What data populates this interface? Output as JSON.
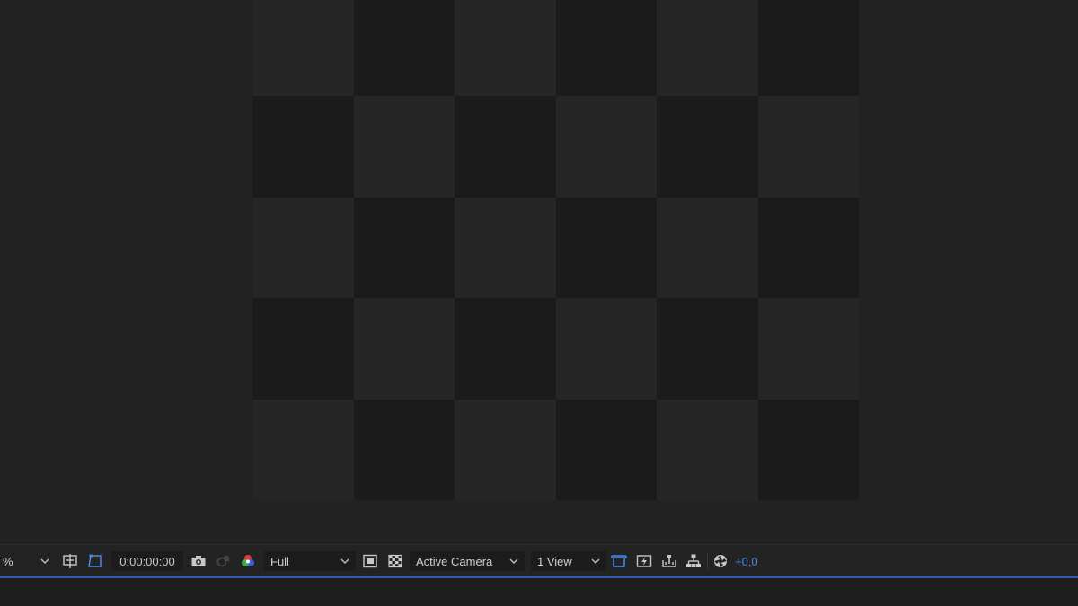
{
  "viewer": {
    "checker_pattern": [
      [
        0,
        1,
        0,
        1,
        0,
        1
      ],
      [
        1,
        0,
        1,
        0,
        1,
        0
      ],
      [
        0,
        1,
        0,
        1,
        0,
        1
      ],
      [
        1,
        0,
        1,
        0,
        1,
        0
      ],
      [
        0,
        1,
        0,
        1,
        0,
        1
      ]
    ]
  },
  "toolbar": {
    "magnification": "%",
    "timecode": "0:00:00:00",
    "resolution": "Full",
    "camera_view": "Active Camera",
    "view_layout": "1 View",
    "exposure": "+0,0"
  },
  "icons": {
    "magnification_chevron": "chevron-down-icon",
    "title_action_safe": "grid-guides-icon",
    "mask_visibility": "mask-path-icon",
    "snapshot": "camera-icon",
    "show_snapshot": "snapshot-show-icon",
    "channel": "color-channels-icon",
    "roi": "region-of-interest-icon",
    "transparency_grid": "transparency-grid-icon",
    "draft_3d": "draft-3d-icon",
    "fast_previews": "fast-previews-icon",
    "timeline": "timeline-icon",
    "flowchart": "flowchart-icon",
    "reset_exposure": "reset-exposure-icon"
  },
  "colors": {
    "accent": "#2e5fb0",
    "exposure_text": "#4f86e6",
    "active_icon": "#4a8be8"
  }
}
